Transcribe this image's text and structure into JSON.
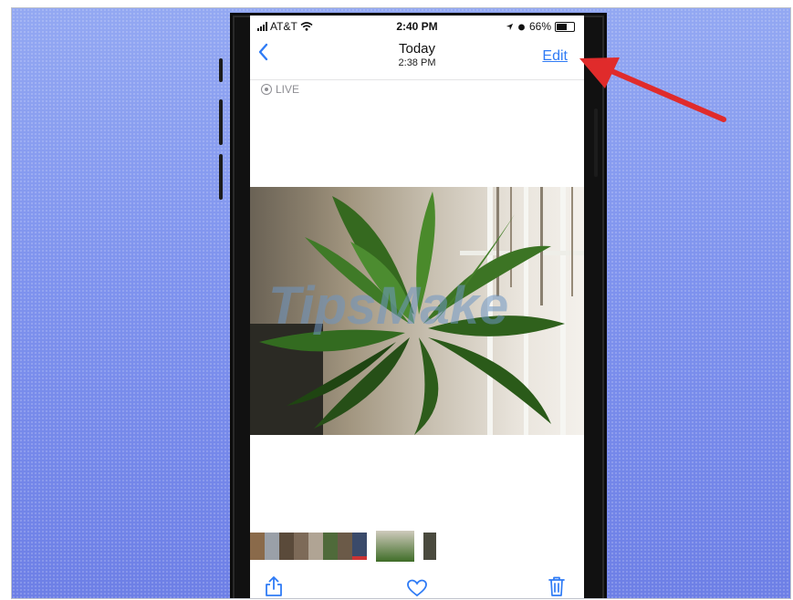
{
  "status": {
    "carrier": "AT&T",
    "time": "2:40 PM",
    "battery": "66%",
    "battery_level": 0.66
  },
  "nav": {
    "back_icon": "chevron-left-icon",
    "title": "Today",
    "subtitle": "2:38 PM",
    "edit_label": "Edit"
  },
  "live_label": "LIVE",
  "watermark": "TipsMake",
  "toolbar": {
    "share_icon": "share-icon",
    "favorite_icon": "heart-icon",
    "delete_icon": "trash-icon"
  },
  "colors": {
    "accent": "#2f7bf5",
    "annotation_arrow": "#e02b2b",
    "background": "#7f93ee"
  }
}
